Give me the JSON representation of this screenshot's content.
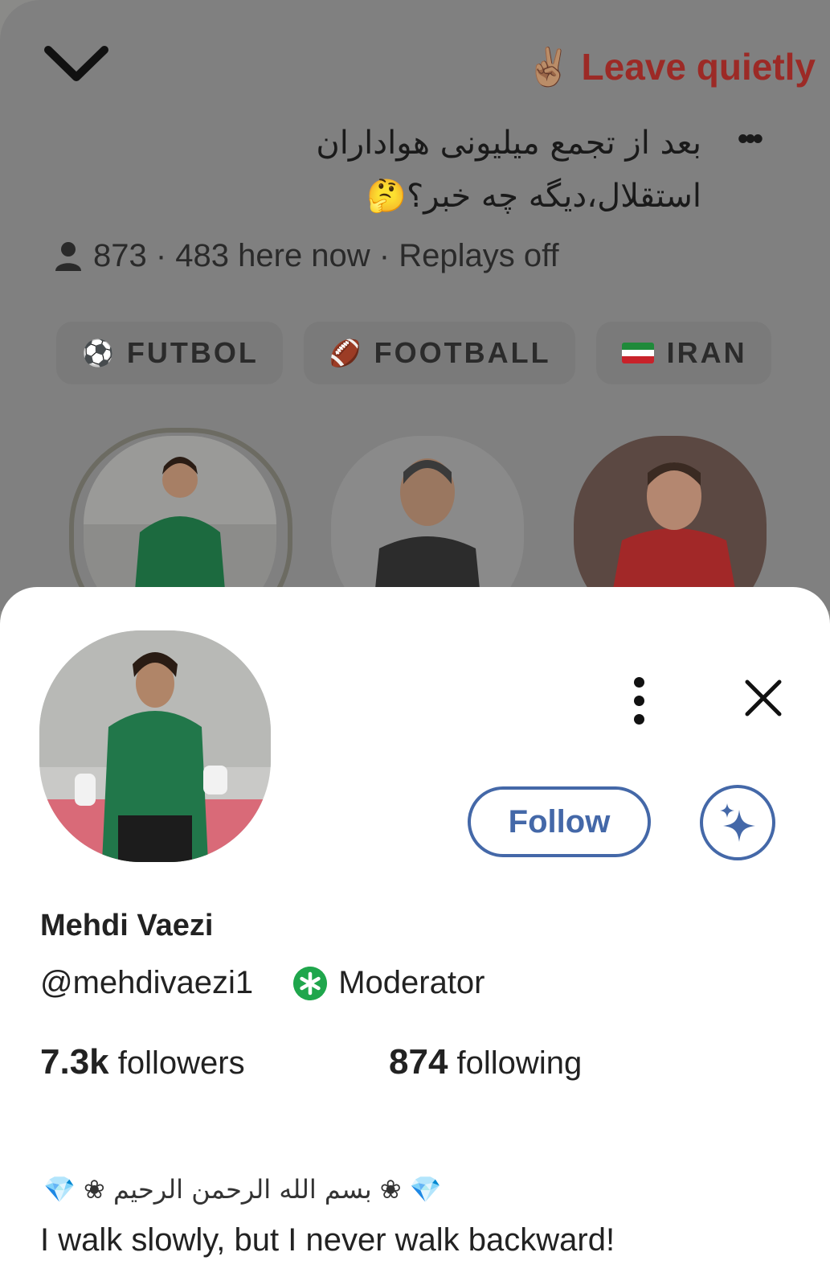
{
  "room": {
    "leave_label": "Leave quietly",
    "leave_emoji": "✌🏽",
    "title": "بعد از تجمع میلیونی هواداران استقلال،دیگه چه خبر؟🤔",
    "more_glyph": "•••",
    "stats": "873 · 483 here now · Replays off",
    "topics": [
      {
        "label": "FUTBOL",
        "icon": "⚽"
      },
      {
        "label": "FOOTBALL",
        "icon": "🏈"
      },
      {
        "label": "IRAN",
        "icon": "iran-flag-icon"
      }
    ]
  },
  "profile": {
    "follow_label": "Follow",
    "name": "Mehdi Vaezi",
    "handle": "@mehdivaezi1",
    "role": "Moderator",
    "followers_count": "7.3k",
    "followers_label": "followers",
    "following_count": "874",
    "following_label": "following",
    "bio_decoration": "💎 ❀ بسم الله الرحمن الرحیم ❀ 💎",
    "bio": "I walk slowly, but I never walk backward!"
  },
  "colors": {
    "accent": "#4468a8",
    "leave": "#9c2a26",
    "moderator": "#1fa64c",
    "overlay": "#808080"
  }
}
